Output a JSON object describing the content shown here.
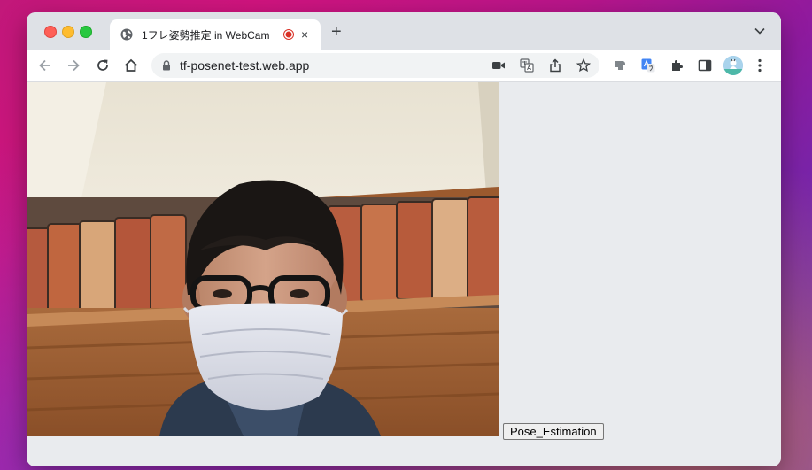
{
  "browser": {
    "tab": {
      "title": "1フレ姿勢推定 in WebCam",
      "favicon": "globe-icon",
      "indicator": "recording-icon",
      "close": "×"
    },
    "new_tab": "+",
    "address": {
      "url": "tf-posenet-test.web.app"
    },
    "colors": {
      "close": "#fe5f57",
      "minimize": "#febc2e",
      "zoom": "#28c840",
      "recording": "#d93025"
    }
  },
  "page": {
    "video": {
      "content": "webcam-feed"
    },
    "button": {
      "label": "Pose_Estimation"
    }
  }
}
